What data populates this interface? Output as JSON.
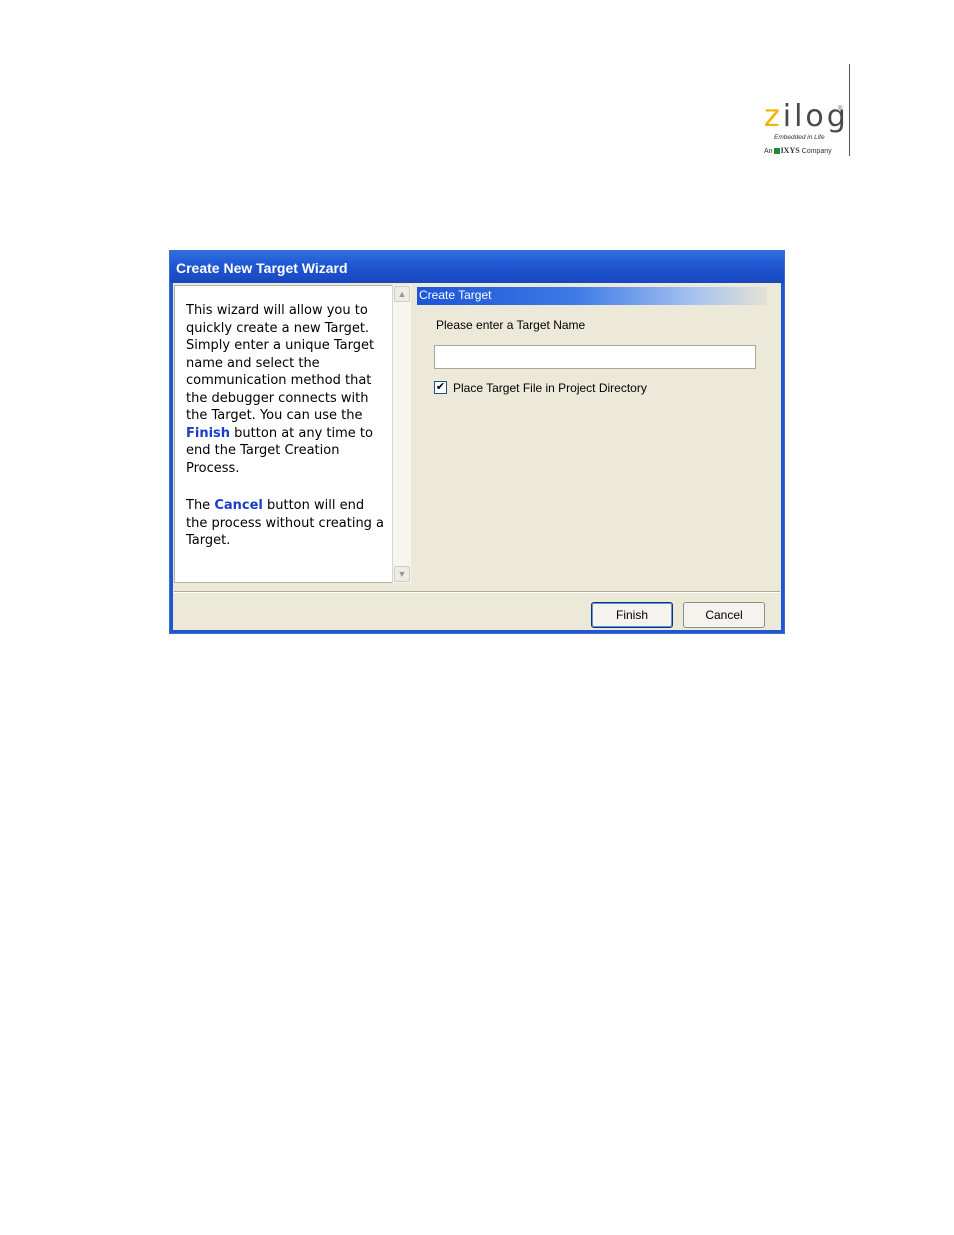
{
  "logo": {
    "word_first": "z",
    "word_rest": "ilog",
    "registered": "®",
    "tagline": "Embedded in Life",
    "company_prefix": "An",
    "company_name": "IXYS",
    "company_suffix": "Company"
  },
  "dialog": {
    "title": "Create New Target Wizard",
    "help": {
      "p1_a": "This wizard will allow you to quickly create a new Target. Simply enter a unique Target name and select the communication method that the debugger connects with the Target. You can use the ",
      "p1_hl": "Finish",
      "p1_b": " button at any time to end the Target Creation Process.",
      "p2_a": "The ",
      "p2_hl": "Cancel",
      "p2_b": " button will end the process without creating a Target."
    },
    "section_title": "Create Target",
    "prompt": "Please enter a Target Name",
    "target_name_value": "",
    "checkbox": {
      "label": "Place Target File in Project Directory",
      "checked": true,
      "mark": "✔"
    },
    "buttons": {
      "finish": "Finish",
      "cancel": "Cancel"
    },
    "scroll": {
      "up": "▲",
      "down": "▼"
    }
  }
}
